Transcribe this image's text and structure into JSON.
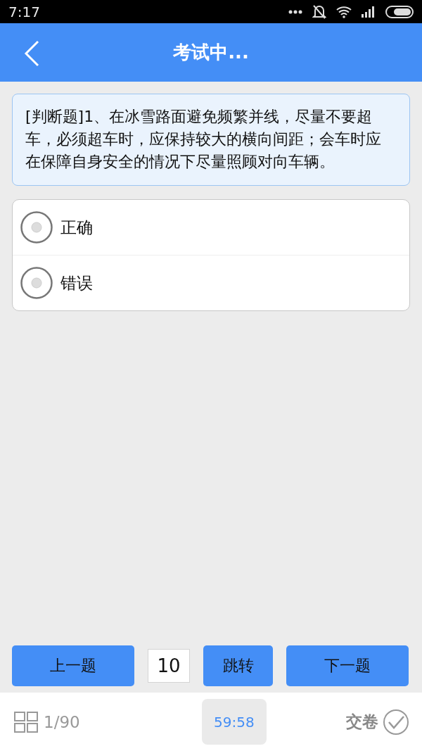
{
  "status_bar": {
    "time": "7:17"
  },
  "header": {
    "title": "考试中..."
  },
  "question": {
    "text": "[判断题]1、在冰雪路面避免频繁并线，尽量不要超车，必须超车时，应保持较大的横向间距；会车时应在保障自身安全的情况下尽量照顾对向车辆。"
  },
  "options": [
    {
      "label": "正确",
      "selected": false
    },
    {
      "label": "错误",
      "selected": false
    }
  ],
  "navigation": {
    "previous": "上一题",
    "jump_value": "10",
    "jump": "跳转",
    "next": "下一题"
  },
  "bottom_bar": {
    "progress": "1/90",
    "timer": "59:58",
    "submit": "交卷"
  }
}
